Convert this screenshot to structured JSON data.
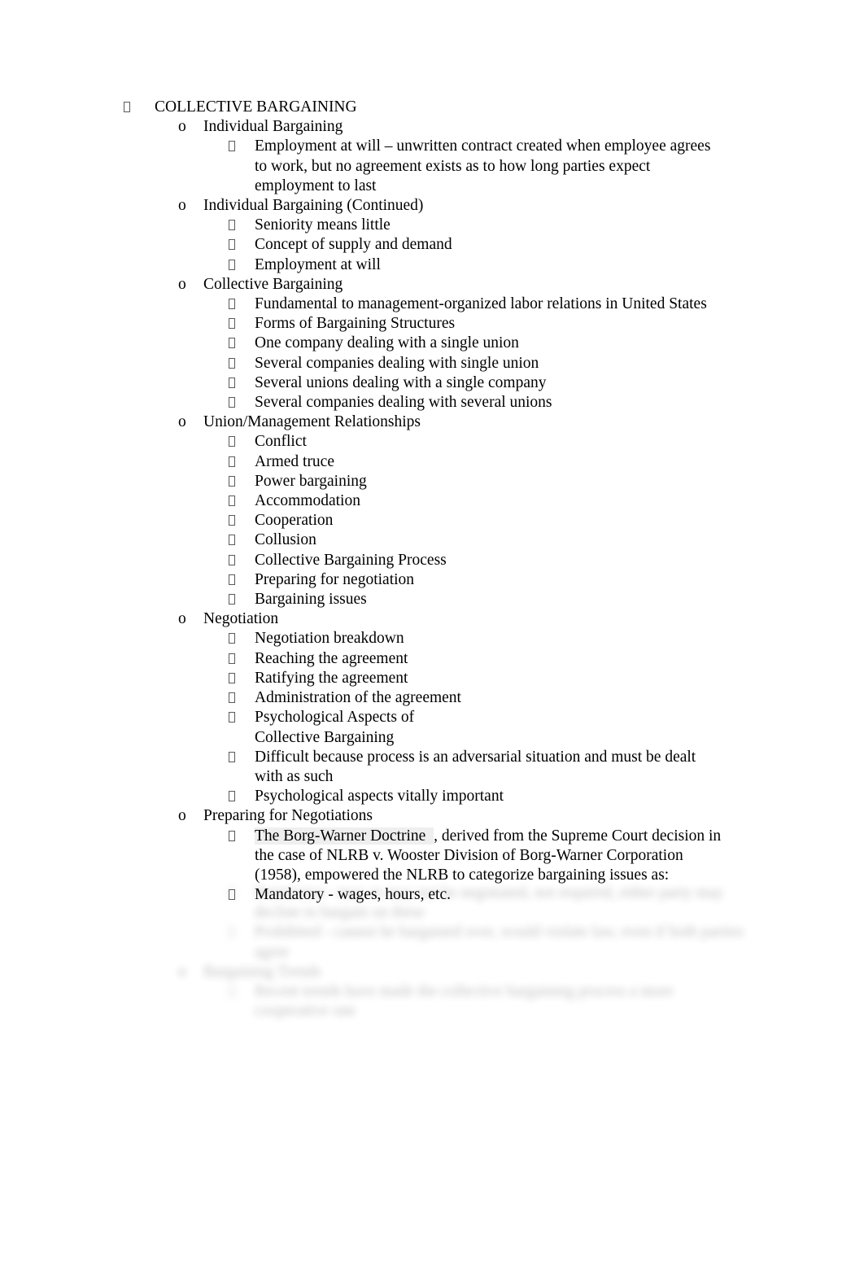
{
  "document": {
    "title": "COLLECTIVE BARGAINING",
    "bullet_glyph": "missing-glyph-box",
    "marker_o": "o",
    "highlight_color": "#efefef",
    "page_background": "#ffffff",
    "text_color": "#000000"
  },
  "outline": {
    "heading": "COLLECTIVE BARGAINING",
    "sections": [
      {
        "heading": "Individual Bargaining",
        "items": [
          "Employment at will – unwritten contract created when employee agrees to work, but no agreement exists as to how long parties expect employment to last"
        ]
      },
      {
        "heading": "Individual Bargaining (Continued)",
        "items": [
          "Seniority means little",
          "Concept of supply and demand",
          "Employment at will"
        ]
      },
      {
        "heading": "Collective Bargaining",
        "items": [
          "Fundamental to management-organized labor relations in United States",
          "Forms of Bargaining Structures",
          "One company dealing with a single union",
          "Several companies dealing with single union",
          "Several unions dealing with a single company",
          "Several companies dealing with several unions"
        ]
      },
      {
        "heading": " Union/Management Relationships",
        "items": [
          "Conflict",
          "Armed truce",
          "Power bargaining",
          "Accommodation",
          "Cooperation",
          "Collusion",
          "Collective Bargaining Process",
          "Preparing for negotiation",
          "Bargaining issues"
        ]
      },
      {
        "heading": "Negotiation",
        "items": [
          "Negotiation breakdown",
          "Reaching the agreement",
          "Ratifying the agreement",
          "Administration of the agreement",
          "Psychological Aspects of\n Collective Bargaining",
          "Difficult because process is an adversarial situation and must be dealt with as such",
          "Psychological aspects vitally important"
        ]
      },
      {
        "heading": "Preparing for Negotiations",
        "items": []
      }
    ],
    "borg_warner": {
      "highlighted": "The Borg-Warner Doctrine  ",
      "rest": ", derived from the Supreme Court decision in the case of   NLRB v. Wooster Division of Borg-Warner Corporation (1958),  empowered the NLRB to categorize bargaining issues as:"
    },
    "mandatory_item": "Mandatory - wages, hours, etc."
  },
  "faded_tail": {
    "note": "blurred-unreadable-text",
    "lines": [
      {
        "level": 3,
        "text": "Permissive - may or may not be negotiated, not required, either party may decline to bargain on these"
      },
      {
        "level": 3,
        "text": "Prohibited - cannot be bargained over, would violate law, even if both parties agree"
      },
      {
        "level": 2,
        "text": "Bargaining Trends"
      },
      {
        "level": 3,
        "text": "Recent trends have made the collective bargaining process a more cooperative one"
      }
    ]
  }
}
